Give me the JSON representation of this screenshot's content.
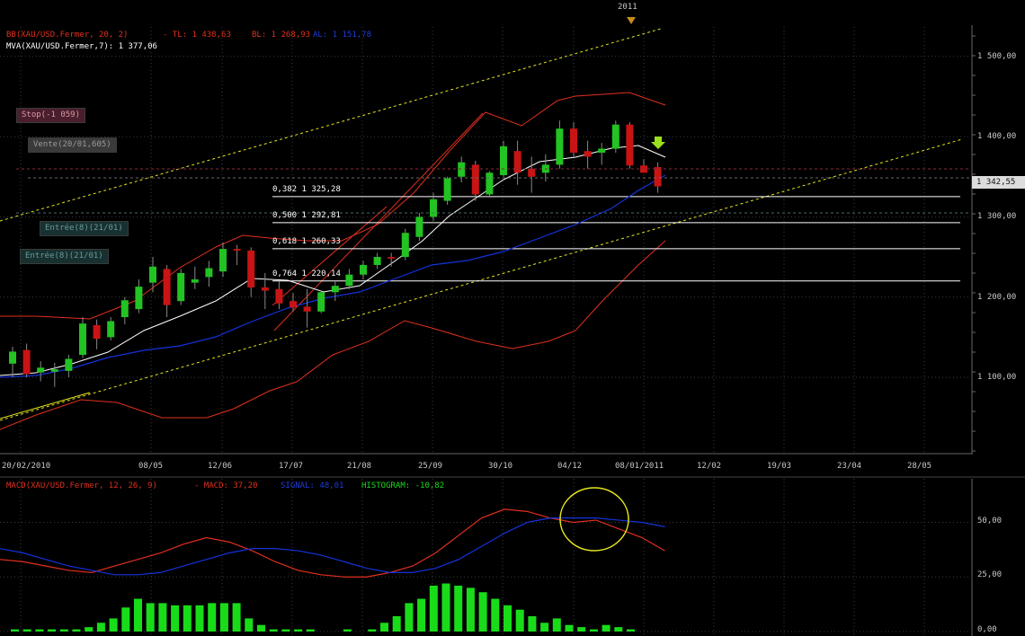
{
  "header": {
    "year_marker": "2011"
  },
  "indicators": {
    "bb": {
      "name": "BB(XAU/USD.Fermer, 20, 2)",
      "tl": "- TL: 1 438,63",
      "bl": "BL: 1 268,93",
      "al": "AL: 1 151,78"
    },
    "mva": "MVA(XAU/USD.Fermer,7): 1 377,06"
  },
  "orders": {
    "stop": "Stop(-1 059)",
    "vente": "Vente(20/01,605)",
    "entree1": "Entrée(8)(21/01)",
    "entree2": "Entrée(8)(21/01)"
  },
  "fib_levels": [
    {
      "label": "0,382 1 325,28",
      "value": 1325.28
    },
    {
      "label": "0,500 1 292,81",
      "value": 1292.81
    },
    {
      "label": "0,618 1 260,33",
      "value": 1260.33
    },
    {
      "label": "0,764 1 220,14",
      "value": 1220.14
    }
  ],
  "price_axis": {
    "ticks": [
      "1 500,00",
      "1 400,00",
      "1 300,00",
      "1 200,00",
      "1 100,00"
    ],
    "tick_values": [
      1500,
      1400,
      1300,
      1200,
      1100
    ],
    "current_price": "1 342,55",
    "current_value": 1342.55
  },
  "time_axis": {
    "labels": [
      "20/02/2010",
      "08/05",
      "12/06",
      "17/07",
      "21/08",
      "25/09",
      "30/10",
      "04/12",
      "08/01/2011",
      "12/02",
      "19/03",
      "23/04",
      "28/05"
    ]
  },
  "macd": {
    "title": "MACD(XAU/USD.Fermer, 12, 26, 9)",
    "macd_text": "- MACD: 37,20",
    "signal_text": "SIGNAL: 48,01",
    "hist_text": "HISTOGRAM: -10,82",
    "axis_ticks": [
      "50,00",
      "25,00",
      "0,00"
    ],
    "axis_values": [
      50,
      25,
      0
    ]
  },
  "colors": {
    "background": "#000000",
    "up_candle": "#22c322",
    "down_candle": "#c81414",
    "bollinger": "#e0301e",
    "mva": "#ffffff",
    "moving_avg_blue": "#1432dc",
    "trendline": "#e6e61e",
    "fib": "#ffffff",
    "histogram": "#19dc19",
    "circle": "#e6e61e"
  },
  "chart_data": [
    {
      "type": "candlestick",
      "title": "XAU/USD",
      "ylim": [
        1020,
        1550
      ],
      "candles": [
        {
          "o": 1117,
          "h": 1138,
          "l": 1100,
          "c": 1132
        },
        {
          "o": 1134,
          "h": 1142,
          "l": 1100,
          "c": 1104
        },
        {
          "o": 1106,
          "h": 1120,
          "l": 1095,
          "c": 1112
        },
        {
          "o": 1107,
          "h": 1118,
          "l": 1088,
          "c": 1110
        },
        {
          "o": 1108,
          "h": 1128,
          "l": 1100,
          "c": 1123
        },
        {
          "o": 1128,
          "h": 1175,
          "l": 1124,
          "c": 1167
        },
        {
          "o": 1165,
          "h": 1172,
          "l": 1135,
          "c": 1148
        },
        {
          "o": 1150,
          "h": 1175,
          "l": 1146,
          "c": 1170
        },
        {
          "o": 1175,
          "h": 1200,
          "l": 1166,
          "c": 1196
        },
        {
          "o": 1185,
          "h": 1222,
          "l": 1180,
          "c": 1213
        },
        {
          "o": 1218,
          "h": 1250,
          "l": 1206,
          "c": 1238
        },
        {
          "o": 1235,
          "h": 1240,
          "l": 1175,
          "c": 1190
        },
        {
          "o": 1195,
          "h": 1235,
          "l": 1190,
          "c": 1230
        },
        {
          "o": 1218,
          "h": 1238,
          "l": 1210,
          "c": 1222
        },
        {
          "o": 1225,
          "h": 1245,
          "l": 1213,
          "c": 1236
        },
        {
          "o": 1232,
          "h": 1268,
          "l": 1225,
          "c": 1260
        },
        {
          "o": 1260,
          "h": 1265,
          "l": 1240,
          "c": 1258
        },
        {
          "o": 1258,
          "h": 1262,
          "l": 1200,
          "c": 1212
        },
        {
          "o": 1212,
          "h": 1230,
          "l": 1185,
          "c": 1208
        },
        {
          "o": 1210,
          "h": 1220,
          "l": 1185,
          "c": 1192
        },
        {
          "o": 1195,
          "h": 1205,
          "l": 1182,
          "c": 1187
        },
        {
          "o": 1188,
          "h": 1210,
          "l": 1162,
          "c": 1182
        },
        {
          "o": 1182,
          "h": 1208,
          "l": 1180,
          "c": 1206
        },
        {
          "o": 1206,
          "h": 1220,
          "l": 1195,
          "c": 1214
        },
        {
          "o": 1214,
          "h": 1235,
          "l": 1210,
          "c": 1228
        },
        {
          "o": 1228,
          "h": 1245,
          "l": 1222,
          "c": 1240
        },
        {
          "o": 1240,
          "h": 1255,
          "l": 1235,
          "c": 1250
        },
        {
          "o": 1250,
          "h": 1255,
          "l": 1238,
          "c": 1248
        },
        {
          "o": 1250,
          "h": 1285,
          "l": 1246,
          "c": 1280
        },
        {
          "o": 1275,
          "h": 1305,
          "l": 1270,
          "c": 1300
        },
        {
          "o": 1300,
          "h": 1330,
          "l": 1295,
          "c": 1322
        },
        {
          "o": 1320,
          "h": 1350,
          "l": 1315,
          "c": 1348
        },
        {
          "o": 1350,
          "h": 1375,
          "l": 1343,
          "c": 1368
        },
        {
          "o": 1365,
          "h": 1370,
          "l": 1320,
          "c": 1328
        },
        {
          "o": 1328,
          "h": 1357,
          "l": 1324,
          "c": 1355
        },
        {
          "o": 1352,
          "h": 1395,
          "l": 1350,
          "c": 1388
        },
        {
          "o": 1382,
          "h": 1395,
          "l": 1340,
          "c": 1355
        },
        {
          "o": 1360,
          "h": 1375,
          "l": 1330,
          "c": 1350
        },
        {
          "o": 1355,
          "h": 1378,
          "l": 1344,
          "c": 1365
        },
        {
          "o": 1365,
          "h": 1420,
          "l": 1360,
          "c": 1410
        },
        {
          "o": 1410,
          "h": 1418,
          "l": 1375,
          "c": 1380
        },
        {
          "o": 1382,
          "h": 1395,
          "l": 1360,
          "c": 1375
        },
        {
          "o": 1380,
          "h": 1392,
          "l": 1365,
          "c": 1385
        },
        {
          "o": 1385,
          "h": 1420,
          "l": 1380,
          "c": 1415
        },
        {
          "o": 1415,
          "h": 1418,
          "l": 1360,
          "c": 1364
        },
        {
          "o": 1364,
          "h": 1372,
          "l": 1355,
          "c": 1355
        },
        {
          "o": 1362,
          "h": 1368,
          "l": 1330,
          "c": 1338
        }
      ]
    },
    {
      "type": "line",
      "title": "MACD",
      "ylim": [
        0,
        70
      ],
      "series": [
        {
          "name": "MACD",
          "values": [
            33,
            32,
            30,
            28,
            27,
            30,
            33,
            36,
            40,
            43,
            41,
            37,
            32,
            28,
            26,
            25,
            25,
            27,
            30,
            36,
            44,
            52,
            56,
            55,
            52,
            50,
            51,
            47,
            43,
            37
          ]
        },
        {
          "name": "SIGNAL",
          "values": [
            38,
            36,
            33,
            30,
            28,
            26,
            26,
            27,
            30,
            33,
            36,
            38,
            38,
            37,
            35,
            32,
            29,
            27,
            27,
            29,
            33,
            39,
            45,
            50,
            52,
            52,
            52,
            51,
            50,
            48
          ]
        }
      ]
    },
    {
      "type": "bar",
      "title": "HISTOGRAM",
      "ylim": [
        0,
        70
      ],
      "values": [
        1,
        1,
        1,
        1,
        1,
        1,
        2,
        4,
        6,
        11,
        15,
        13,
        13,
        12,
        12,
        12,
        13,
        13,
        13,
        6,
        3,
        1,
        1,
        1,
        1,
        0,
        0,
        1,
        0,
        1,
        4,
        7,
        13,
        15,
        21,
        22,
        21,
        20,
        18,
        15,
        12,
        10,
        7,
        4,
        6,
        3,
        2,
        1,
        3,
        2,
        1,
        0,
        0,
        0
      ]
    }
  ]
}
